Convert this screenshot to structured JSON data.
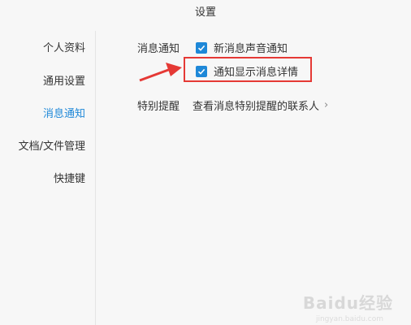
{
  "window": {
    "title": "设置"
  },
  "sidebar": {
    "items": [
      {
        "label": "个人资料",
        "active": false
      },
      {
        "label": "通用设置",
        "active": false
      },
      {
        "label": "消息通知",
        "active": true
      },
      {
        "label": "文档/文件管理",
        "active": false
      },
      {
        "label": "快捷键",
        "active": false
      }
    ]
  },
  "notifications": {
    "section_label": "消息通知",
    "options": [
      {
        "label": "新消息声音通知",
        "checked": true
      },
      {
        "label": "通知显示消息详情",
        "checked": true
      }
    ]
  },
  "special_reminder": {
    "section_label": "特别提醒",
    "link_label": "查看消息特别提醒的联系人"
  },
  "watermark": {
    "text": "Baidu经验",
    "sub": "jingyan.baidu.com"
  },
  "colors": {
    "accent": "#1e88d8",
    "highlight": "#e53935",
    "background": "#f7f7f7"
  }
}
